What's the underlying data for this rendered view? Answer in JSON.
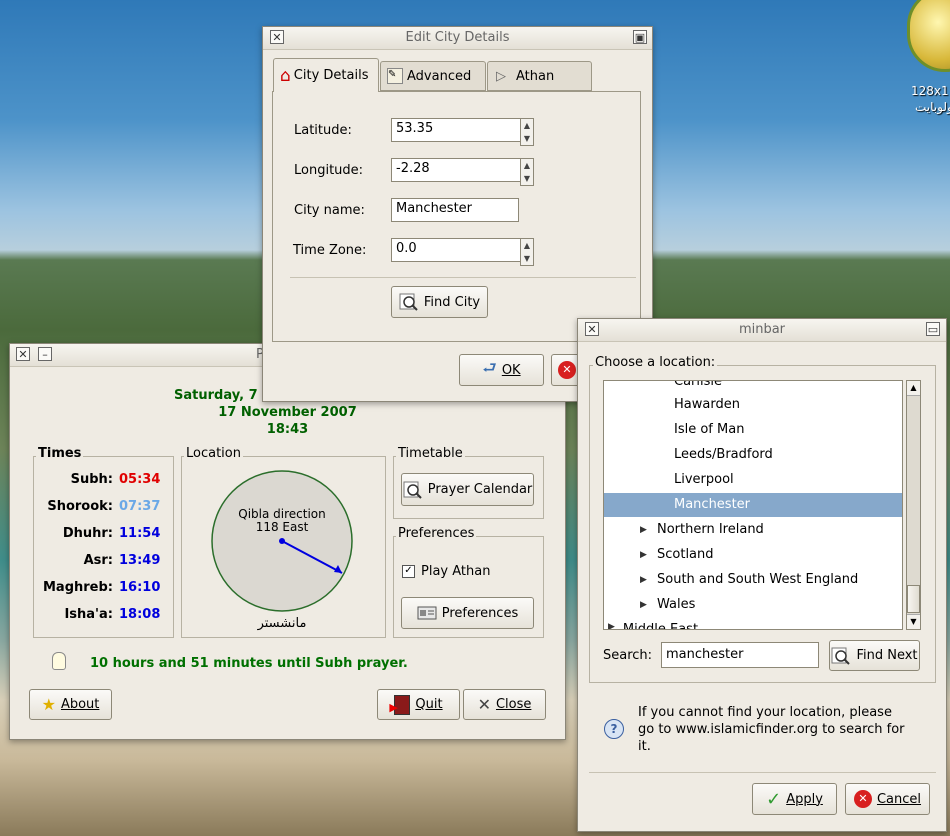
{
  "desktop": {
    "icon_label_1": "128x1",
    "icon_label_2": "ولوبايت"
  },
  "edit_city": {
    "title": "Edit City Details",
    "tabs": [
      "City Details",
      "Advanced",
      "Athan"
    ],
    "latitude_label": "Latitude:",
    "latitude_value": "53.35",
    "longitude_label": "Longitude:",
    "longitude_value": "-2.28",
    "city_label": "City name:",
    "city_value": "Manchester",
    "tz_label": "Time Zone:",
    "tz_value": "0.0",
    "find_city": "Find City",
    "ok": "OK"
  },
  "main": {
    "title_partial": "P",
    "date_line1": "Saturday, 7",
    "date_line2": "17 November 2007",
    "time": "18:43",
    "times_title": "Times",
    "prayers": [
      {
        "name": "Subh:",
        "time": "05:34",
        "color": "#e00000"
      },
      {
        "name": "Shorook:",
        "time": "07:37",
        "color": "#6aa8e6"
      },
      {
        "name": "Dhuhr:",
        "time": "11:54",
        "color": "#0000dd"
      },
      {
        "name": "Asr:",
        "time": "13:49",
        "color": "#0000dd"
      },
      {
        "name": "Maghreb:",
        "time": "16:10",
        "color": "#0000dd"
      },
      {
        "name": "Isha'a:",
        "time": "18:08",
        "color": "#0000dd"
      }
    ],
    "location_title": "Location",
    "qibla_line1": "Qibla direction",
    "qibla_line2": "118 East",
    "city_arabic": "مانشستر",
    "timetable_title": "Timetable",
    "prayer_calendar": "Prayer Calendar",
    "preferences_title": "Preferences",
    "play_athan": "Play Athan",
    "preferences_btn": "Preferences",
    "notice": "10 hours and 51 minutes until Subh prayer.",
    "about": "About",
    "quit": "Quit",
    "close": "Close"
  },
  "minbar": {
    "title": "minbar",
    "choose_label": "Choose a location:",
    "cut_top": "Carlisle",
    "items": [
      "Hawarden",
      "Isle of Man",
      "Leeds/Bradford",
      "Liverpool",
      "Manchester"
    ],
    "selected": "Manchester",
    "groups": [
      "Northern Ireland",
      "Scotland",
      "South and South West England",
      "Wales"
    ],
    "cut_bottom": "Middle East",
    "search_label": "Search:",
    "search_value": "manchester",
    "find_next": "Find Next",
    "info": "If you cannot find your location, please go to www.islamicfinder.org to search for it.",
    "apply": "Apply",
    "cancel": "Cancel"
  }
}
